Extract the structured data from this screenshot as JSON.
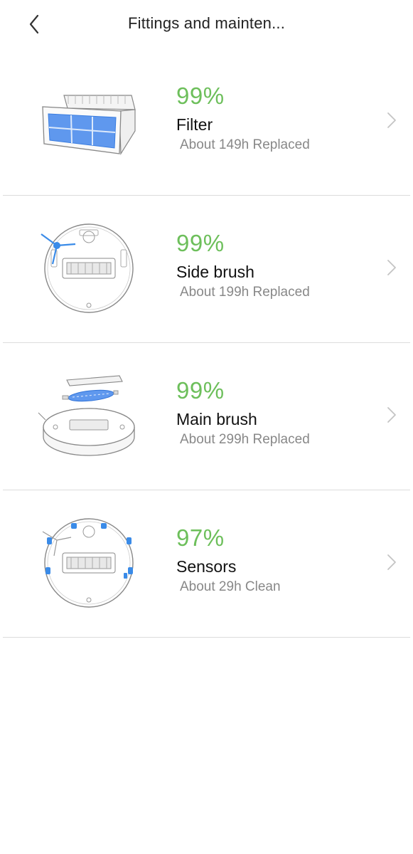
{
  "header": {
    "title": "Fittings and mainten...",
    "back_icon": "chevron-left-icon"
  },
  "colors": {
    "percent": "#6dbf5b",
    "accent_blue": "#3a8be8",
    "divider": "#dcdcdc"
  },
  "items": [
    {
      "percent": "99%",
      "name": "Filter",
      "subtitle": "About 149h Replaced",
      "icon": "filter-image"
    },
    {
      "percent": "99%",
      "name": "Side brush",
      "subtitle": "About 199h Replaced",
      "icon": "side-brush-image"
    },
    {
      "percent": "99%",
      "name": "Main brush",
      "subtitle": "About 299h Replaced",
      "icon": "main-brush-image"
    },
    {
      "percent": "97%",
      "name": "Sensors",
      "subtitle": "About 29h Clean",
      "icon": "sensors-image"
    }
  ]
}
